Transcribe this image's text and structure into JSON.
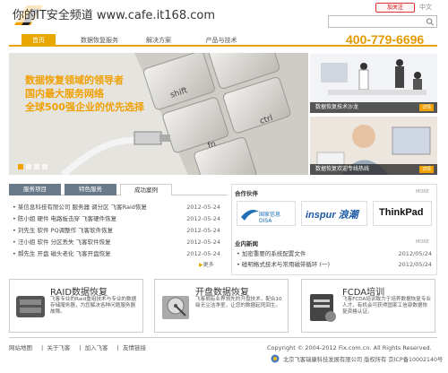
{
  "watermark": "你的IT安全频道 www.cafe.it168.com",
  "header": {
    "follow_label": "加关注",
    "lang_label": "中文",
    "search_placeholder": ""
  },
  "nav": {
    "items": [
      "首页",
      "数据恢复服务",
      "解决方案",
      "产品与技术"
    ],
    "active_index": 0,
    "phone": "400-779-6696",
    "accent": "#e8a800"
  },
  "banner": {
    "lines": [
      "数据恢复领域的领导者",
      "国内最大服务网络",
      "全球500强企业的优先选择"
    ],
    "keys": [
      "shift",
      "ctrl",
      "fn"
    ],
    "side_items": [
      {
        "caption": "数据恢复技术沙龙",
        "button": "详情"
      },
      {
        "caption": "数据恢复欢迎专线热线",
        "button": "详情"
      }
    ]
  },
  "news": {
    "tabs": [
      "服务项目",
      "特色服务",
      "成功案例"
    ],
    "active_tab": 2,
    "rows": [
      {
        "title": "• 某信息科技有限公司 服务器 调分区 飞客Raid恢复",
        "date": "2012-05-24"
      },
      {
        "title": "• 陈小姐 硬件 电路板击穿 飞客硬件恢复",
        "date": "2012-05-24"
      },
      {
        "title": "• 刘先生 软件 PQ调整作 飞客软件恢复",
        "date": "2012-05-24"
      },
      {
        "title": "• 汪小姐 软件 分区丢失 飞客软件恢复",
        "date": "2012-05-24"
      },
      {
        "title": "• 郝先生 开盘 磁头老化 飞客开盘恢复",
        "date": "2012-05-24"
      }
    ],
    "more_label": "更多"
  },
  "partners": {
    "title": "合作伙伴",
    "more": "MORE",
    "logos": [
      "国家信息 DISA",
      "inspur 浪潮",
      "ThinkPad"
    ],
    "industry_title": "业内新闻",
    "industry_more": "MORE",
    "industry_rows": [
      {
        "title": "• 加密重要的系统配置文件",
        "date": "2012/05/24"
      },
      {
        "title": "• 碰明格式技术与常用磁带循环 (一)",
        "date": "2012/05/24"
      }
    ]
  },
  "features": [
    {
      "title": "RAID数据恢复",
      "desc": "飞客专业的Raid重组技术与专业的数据存储服务器，为您解决各种问题服务器故障。",
      "icon": "raid-icon"
    },
    {
      "title": "开盘数据恢复",
      "desc": "飞客拥有业界领先的开盘技术，配合10级无尘洁净室，让您的数据起死回生。",
      "icon": "harddisk-icon"
    },
    {
      "title": "FCDA培训",
      "desc": "飞客FCDA培训致力于培养数据恢复专业人才，有机会可获得国家工信部数据恢复资格认证。",
      "icon": "training-icon"
    }
  ],
  "footer": {
    "links": [
      "网站地图",
      "关于飞客",
      "加入飞客",
      "友情链接"
    ],
    "copyright": "Copyright © 2004-2012 Fix.com.cn. All Rights Reserved.",
    "icp": "北京飞客瑞康科技发展有限公司 版权所有 京ICP备10002140号"
  }
}
